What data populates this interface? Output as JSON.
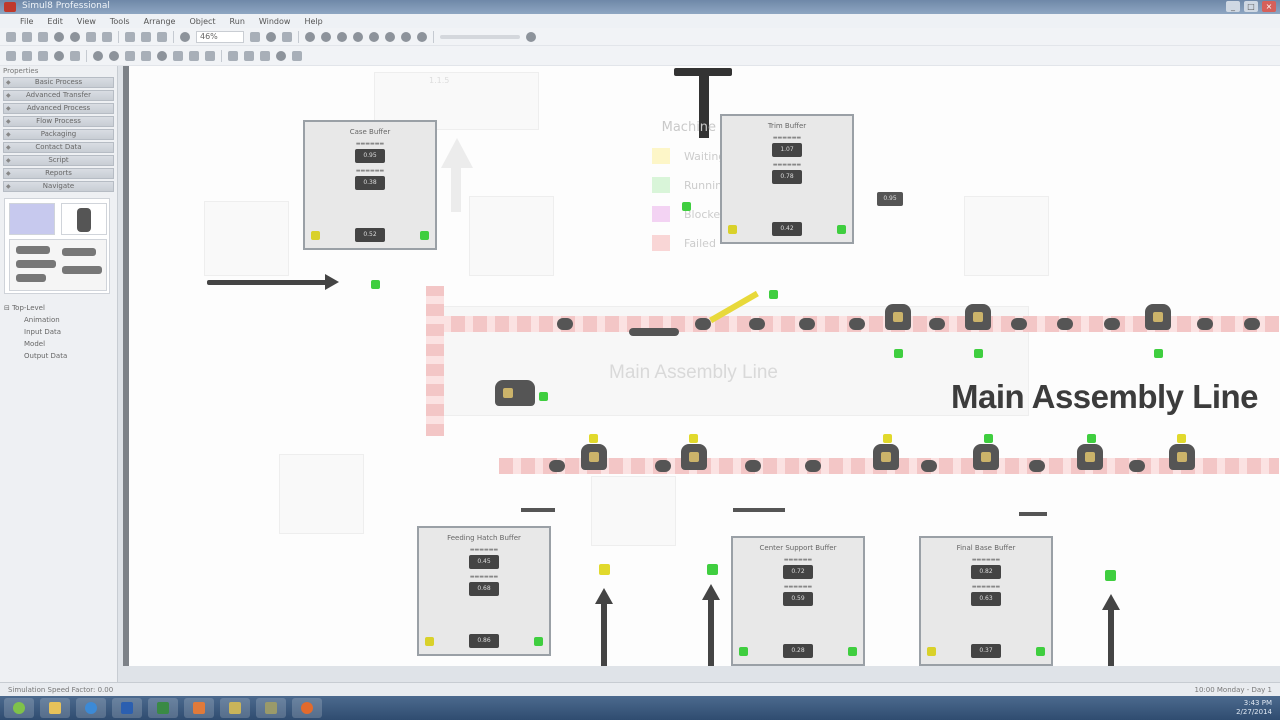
{
  "window": {
    "title": "Simul8 Professional",
    "controls": [
      "_",
      "□",
      "×"
    ]
  },
  "menu": [
    "File",
    "Edit",
    "View",
    "Tools",
    "Arrange",
    "Object",
    "Run",
    "Window",
    "Help"
  ],
  "toolbar": {
    "zoom_value": "46%"
  },
  "left_panel": {
    "header": "Properties",
    "library_items": [
      "Basic Process",
      "Advanced Transfer",
      "Advanced Process",
      "Flow Process",
      "Packaging",
      "Contact Data",
      "Script",
      "Reports",
      "Navigate"
    ],
    "tree": {
      "root": "Top-Level",
      "children": [
        "Animation",
        "Input Data",
        "Model",
        "Output Data"
      ]
    }
  },
  "canvas": {
    "main_title": "Main Assembly Line",
    "ghost_title": "Main Assembly Line",
    "legend": {
      "title": "Machine States",
      "items": [
        {
          "label": "Waiting / Starved",
          "color": "#fdf6c8"
        },
        {
          "label": "Running",
          "color": "#d9f5d9"
        },
        {
          "label": "Blocked",
          "color": "#f3d3f3"
        },
        {
          "label": "Failed",
          "color": "#f9d6d6"
        }
      ]
    },
    "buffers": [
      {
        "title": "Case Buffer",
        "upper": "0.95",
        "lower": "0.38",
        "bottom": "0.52"
      },
      {
        "title": "Trim Buffer",
        "upper": "1.07",
        "lower": "0.78",
        "bottom": "0.42"
      },
      {
        "title": "Feeding Hatch Buffer",
        "upper": "0.45",
        "lower": "0.68",
        "bottom": "0.86"
      },
      {
        "title": "Center Support Buffer",
        "upper": "0.72",
        "lower": "0.59",
        "bottom": "0.28"
      },
      {
        "title": "Final Base Buffer",
        "upper": "0.82",
        "lower": "0.63",
        "bottom": "0.37"
      }
    ],
    "small_readout": "0.95",
    "small_readout_2": "1.1.5"
  },
  "status": {
    "left": "Simulation Speed Factor: 0.00",
    "right": "10:00 Monday - Day 1"
  },
  "taskbar": {
    "time": "3:43 PM",
    "date": "2/27/2014"
  }
}
